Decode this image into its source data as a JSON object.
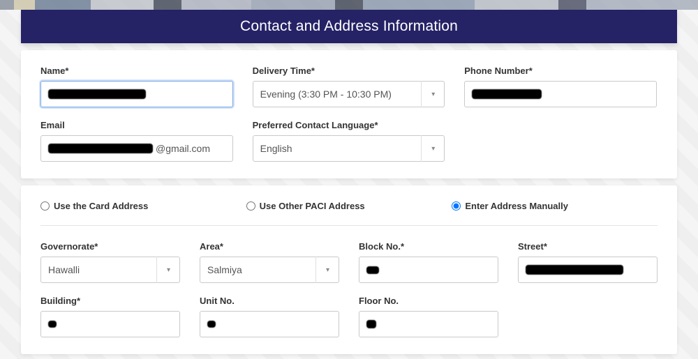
{
  "title": "Contact and Address Information",
  "card1": {
    "name": {
      "label": "Name*",
      "masked": true
    },
    "delivery": {
      "label": "Delivery Time*",
      "value": "Evening (3:30 PM - 10:30 PM)"
    },
    "phone": {
      "label": "Phone Number*",
      "masked": true
    },
    "email": {
      "label": "Email",
      "suffix": "@gmail.com",
      "masked": true
    },
    "language": {
      "label": "Preferred Contact Language*",
      "value": "English"
    }
  },
  "radios": {
    "card_addr": "Use the Card Address",
    "paci": "Use Other PACI Address",
    "manual": "Enter Address Manually",
    "selected": "manual"
  },
  "addr": {
    "governorate": {
      "label": "Governorate*",
      "value": "Hawalli"
    },
    "area": {
      "label": "Area*",
      "value": "Salmiya"
    },
    "block": {
      "label": "Block No.*",
      "masked": true
    },
    "street": {
      "label": "Street*",
      "masked": true
    },
    "building": {
      "label": "Building*",
      "masked": true
    },
    "unit": {
      "label": "Unit No.",
      "masked": true
    },
    "floor": {
      "label": "Floor No.",
      "masked": true
    }
  }
}
